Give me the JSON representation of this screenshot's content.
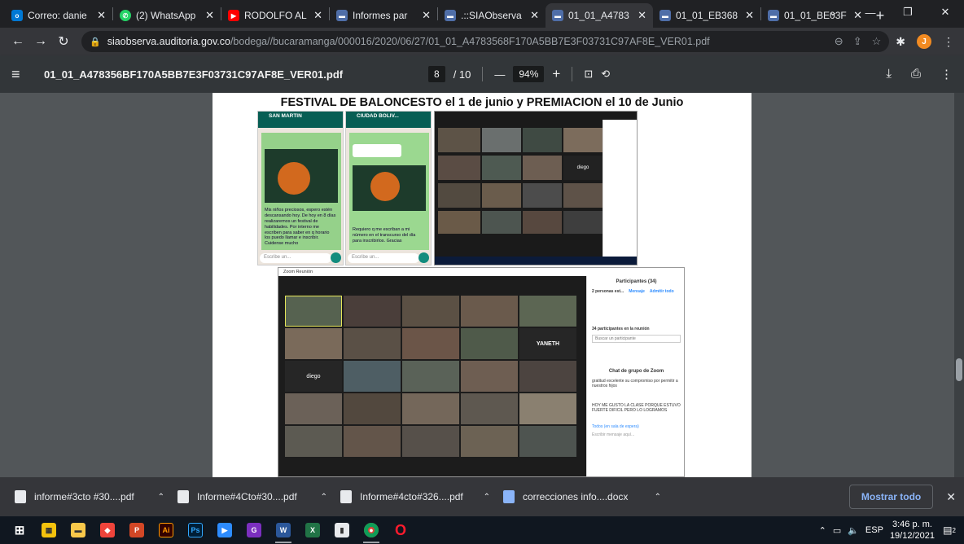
{
  "tabs": [
    {
      "title": "Correo: danie",
      "icon": "outlook-icon",
      "color": "#0078d4"
    },
    {
      "title": "(2) WhatsApp",
      "icon": "whatsapp-icon",
      "color": "#25d366"
    },
    {
      "title": "RODOLFO AL",
      "icon": "youtube-icon",
      "color": "#ff0000"
    },
    {
      "title": "Informes par",
      "icon": "sia-icon",
      "color": "#4f6ea8"
    },
    {
      "title": ".::SIAObserva",
      "icon": "sia-icon",
      "color": "#4f6ea8"
    },
    {
      "title": "01_01_A4783",
      "icon": "sia-icon",
      "color": "#4f6ea8",
      "active": true
    },
    {
      "title": "01_01_EB368",
      "icon": "sia-icon",
      "color": "#4f6ea8"
    },
    {
      "title": "01_01_BE03F",
      "icon": "sia-icon",
      "color": "#4f6ea8"
    }
  ],
  "address": {
    "domain": "siaobserva.auditoria.gov.co",
    "path": "/bodega//bucaramanga/000016/2020/06/27/01_01_A4783568F170A5BB7E3F03731C97AF8E_VER01.pdf"
  },
  "profile_initial": "J",
  "pdf": {
    "filename": "01_01_A478356BF170A5BB7E3F03731C97AF8E_VER01.pdf",
    "page_current": "8",
    "page_total": "/ 10",
    "zoom": "94%",
    "minus": "—",
    "plus": "+"
  },
  "page_content": {
    "title": "FESTIVAL DE BALONCESTO el 1 de junio y PREMIACION el 10 de Junio",
    "phone1": {
      "contact": "SAN MARTIN",
      "message": "Mis niños preciosos, espero estén descansando hoy. De hoy en 8 días realizaremos un festival de habilidades. Por interno me escriben para saber en q horario los puedo llamar e inscribir. Cuidense mucho",
      "input": "Escribe un..."
    },
    "phone2": {
      "contact": "CIUDAD BOLIV...",
      "message": "Requiero q me escriban a mi número en el transcurso del día para inscribirlos. Gracias",
      "input": "Escribe un..."
    },
    "zoom_top_name": "diego",
    "zoom_bottom": {
      "title": "Zoom Reunión",
      "participants_header": "Participantes (34)",
      "waiting": "2 personas est...",
      "message_btn": "Mensaje",
      "admit_btn": "Admitir todo",
      "in_meeting": "34 participantes en la reunión",
      "search": "Buscar un participante",
      "chat_header": "Chat de grupo de Zoom",
      "chat_line1": "gratitud excelente su compromiso por permitir a nuestros hijos",
      "chat_line2": "HOY ME GUSTO LA CLASE PORQUE ESTUVO FUERTE DIFICIL PERO LO LOGRAMOS",
      "send_to": "Todos (en sala de espera)",
      "compose": "Escribir mensaje aquí...",
      "tile_yaneth": "YANETH",
      "tile_diego": "diego"
    }
  },
  "downloads": [
    {
      "name": "informe#3cto #30....pdf",
      "type": "pdf"
    },
    {
      "name": "Informe#4Cto#30....pdf",
      "type": "pdf"
    },
    {
      "name": "Informe#4cto#326....pdf",
      "type": "pdf"
    },
    {
      "name": "correcciones info....docx",
      "type": "docx"
    }
  ],
  "show_all": "Mostrar todo",
  "taskbar": {
    "lang": "ESP",
    "time": "3:46 p. m.",
    "date": "19/12/2021",
    "notifications": "2"
  }
}
